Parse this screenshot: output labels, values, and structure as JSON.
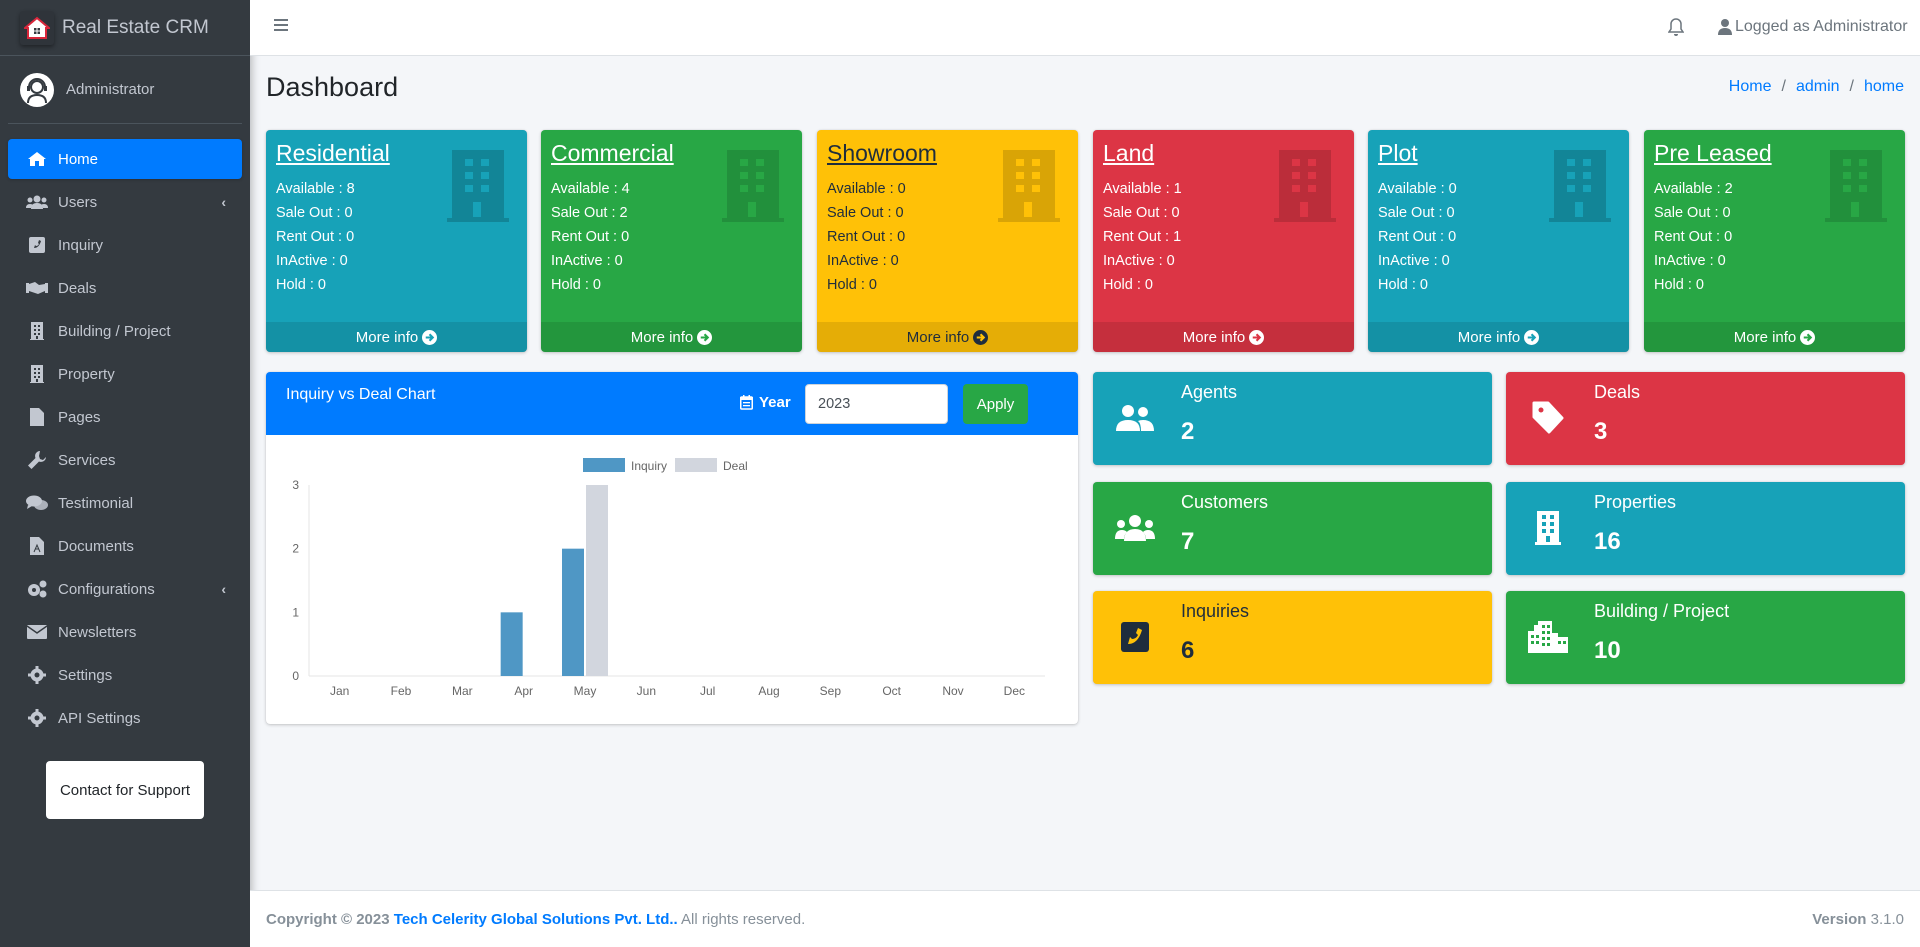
{
  "brand": {
    "name": "Real Estate CRM"
  },
  "user": {
    "name": "Administrator"
  },
  "sidebar": {
    "items": [
      {
        "label": "Home",
        "icon": "home-icon",
        "active": true
      },
      {
        "label": "Users",
        "icon": "users-icon",
        "has_children": true
      },
      {
        "label": "Inquiry",
        "icon": "phone-square-icon"
      },
      {
        "label": "Deals",
        "icon": "handshake-icon"
      },
      {
        "label": "Building / Project",
        "icon": "building-icon"
      },
      {
        "label": "Property",
        "icon": "building-icon"
      },
      {
        "label": "Pages",
        "icon": "file-icon"
      },
      {
        "label": "Services",
        "icon": "wrench-icon"
      },
      {
        "label": "Testimonial",
        "icon": "comments-icon"
      },
      {
        "label": "Documents",
        "icon": "file-pdf-icon"
      },
      {
        "label": "Configurations",
        "icon": "cogs-icon",
        "has_children": true
      },
      {
        "label": "Newsletters",
        "icon": "envelope-icon"
      },
      {
        "label": "Settings",
        "icon": "cog-icon"
      },
      {
        "label": "API Settings",
        "icon": "cog-icon"
      }
    ],
    "support_label": "Contact for Support"
  },
  "topbar": {
    "logged_as": "Logged as Administrator"
  },
  "header": {
    "title": "Dashboard",
    "breadcrumb": [
      "Home",
      "admin",
      "home"
    ]
  },
  "property_boxes": [
    {
      "title": "Residential",
      "color": "#17a2b8",
      "available": "Available : 8",
      "sale_out": "Sale Out : 0",
      "rent_out": "Rent Out : 0",
      "inactive": "InActive : 0",
      "hold": "Hold : 0",
      "more": "More info"
    },
    {
      "title": "Commercial",
      "color": "#28a745",
      "available": "Available : 4",
      "sale_out": "Sale Out : 2",
      "rent_out": "Rent Out : 0",
      "inactive": "InActive : 0",
      "hold": "Hold : 0",
      "more": "More info"
    },
    {
      "title": "Showroom",
      "color": "#ffc107",
      "available": "Available : 0",
      "sale_out": "Sale Out : 0",
      "rent_out": "Rent Out : 0",
      "inactive": "InActive : 0",
      "hold": "Hold : 0",
      "more": "More info"
    },
    {
      "title": "Land",
      "color": "#dc3545",
      "available": "Available : 1",
      "sale_out": "Sale Out : 0",
      "rent_out": "Rent Out : 1",
      "inactive": "InActive : 0",
      "hold": "Hold : 0",
      "more": "More info"
    },
    {
      "title": "Plot",
      "color": "#17a2b8",
      "available": "Available : 0",
      "sale_out": "Sale Out : 0",
      "rent_out": "Rent Out : 0",
      "inactive": "InActive : 0",
      "hold": "Hold : 0",
      "more": "More info"
    },
    {
      "title": "Pre Leased",
      "color": "#28a745",
      "available": "Available : 2",
      "sale_out": "Sale Out : 0",
      "rent_out": "Rent Out : 0",
      "inactive": "InActive : 0",
      "hold": "Hold : 0",
      "more": "More info"
    }
  ],
  "chart_card": {
    "title": "Inquiry vs Deal Chart",
    "year_label": "Year",
    "year_value": "2023",
    "apply_label": "Apply"
  },
  "chart_data": {
    "type": "bar",
    "title": "Inquiry vs Deal Chart",
    "xlabel": "",
    "ylabel": "",
    "categories": [
      "Jan",
      "Feb",
      "Mar",
      "Apr",
      "May",
      "Jun",
      "Jul",
      "Aug",
      "Sep",
      "Oct",
      "Nov",
      "Dec"
    ],
    "series": [
      {
        "name": "Inquiry",
        "color": "#4f97c5",
        "values": [
          0,
          0,
          0,
          1,
          2,
          0,
          0,
          0,
          0,
          0,
          0,
          0
        ]
      },
      {
        "name": "Deal",
        "color": "#d2d6de",
        "values": [
          0,
          0,
          0,
          0,
          3,
          0,
          0,
          0,
          0,
          0,
          0,
          0
        ]
      }
    ],
    "ylim": [
      0,
      3
    ],
    "yticks": [
      "0",
      "1",
      "2",
      "3"
    ],
    "grid": false,
    "legend": "top-center"
  },
  "info_boxes": [
    {
      "label": "Agents",
      "value": "2",
      "color": "#17a2b8",
      "icon": "user-friends-icon"
    },
    {
      "label": "Deals",
      "value": "3",
      "color": "#dc3545",
      "icon": "tag-icon"
    },
    {
      "label": "Customers",
      "value": "7",
      "color": "#28a745",
      "icon": "users-icon"
    },
    {
      "label": "Properties",
      "value": "16",
      "color": "#17a2b8",
      "icon": "building-icon"
    },
    {
      "label": "Inquiries",
      "value": "6",
      "color": "#ffc107",
      "icon": "phone-square-icon"
    },
    {
      "label": "Building / Project",
      "value": "10",
      "color": "#28a745",
      "icon": "city-icon"
    }
  ],
  "footer": {
    "copyright_prefix": "Copyright © 2023",
    "company": "Tech Celerity Global Solutions Pvt. Ltd..",
    "rights": "All rights reserved.",
    "version_label": "Version",
    "version": "3.1.0"
  }
}
